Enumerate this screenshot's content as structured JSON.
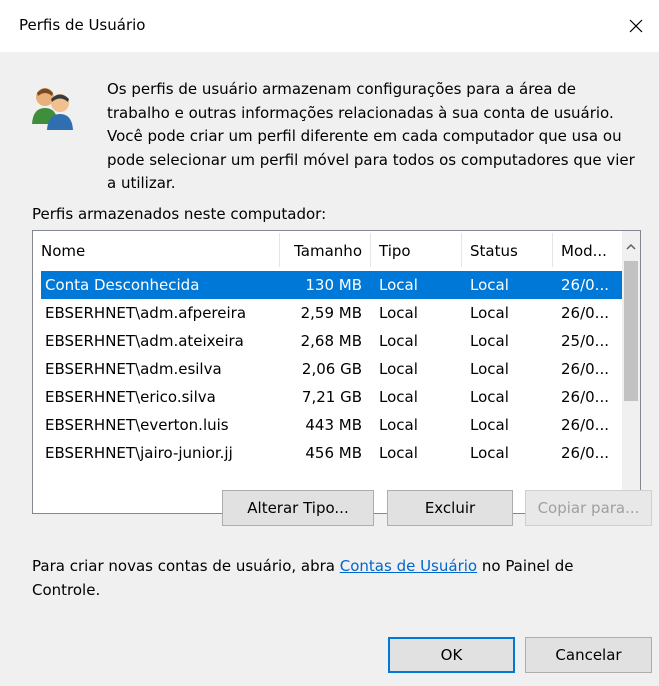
{
  "window": {
    "title": "Perfis de Usuário",
    "close_icon": "close-icon"
  },
  "description": "Os perfis de usuário armazenam configurações para a área de trabalho e outras informações relacionadas à sua conta de usuário. Você pode criar um perfil diferente em cada computador que usa ou pode selecionar um perfil móvel para todos os computadores que vier a utilizar.",
  "profiles_label": "Perfis armazenados neste computador:",
  "list": {
    "columns": [
      "Nome",
      "Tamanho",
      "Tipo",
      "Status",
      "Mod..."
    ],
    "rows": [
      {
        "nome": "Conta Desconhecida",
        "tamanho": "130 MB",
        "tipo": "Local",
        "status": "Local",
        "mod": "26/0...",
        "selected": true
      },
      {
        "nome": "EBSERHNET\\adm.afpereira",
        "tamanho": "2,59 MB",
        "tipo": "Local",
        "status": "Local",
        "mod": "26/0..."
      },
      {
        "nome": "EBSERHNET\\adm.ateixeira",
        "tamanho": "2,68 MB",
        "tipo": "Local",
        "status": "Local",
        "mod": "25/0..."
      },
      {
        "nome": "EBSERHNET\\adm.esilva",
        "tamanho": "2,06 GB",
        "tipo": "Local",
        "status": "Local",
        "mod": "26/0..."
      },
      {
        "nome": "EBSERHNET\\erico.silva",
        "tamanho": "7,21 GB",
        "tipo": "Local",
        "status": "Local",
        "mod": "26/0..."
      },
      {
        "nome": "EBSERHNET\\everton.luis",
        "tamanho": "443 MB",
        "tipo": "Local",
        "status": "Local",
        "mod": "26/0..."
      },
      {
        "nome": "EBSERHNET\\jairo-junior.jj",
        "tamanho": "456 MB",
        "tipo": "Local",
        "status": "Local",
        "mod": "26/0..."
      }
    ]
  },
  "buttons": {
    "alterar_tipo": "Alterar Tipo...",
    "excluir": "Excluir",
    "copiar_para": "Copiar para...",
    "ok": "OK",
    "cancelar": "Cancelar"
  },
  "footer": {
    "before": "Para criar novas contas de usuário, abra ",
    "link": "Contas de Usuário",
    "after": " no Painel de Controle."
  },
  "colors": {
    "selection": "#0078d7",
    "link": "#0066cc"
  }
}
